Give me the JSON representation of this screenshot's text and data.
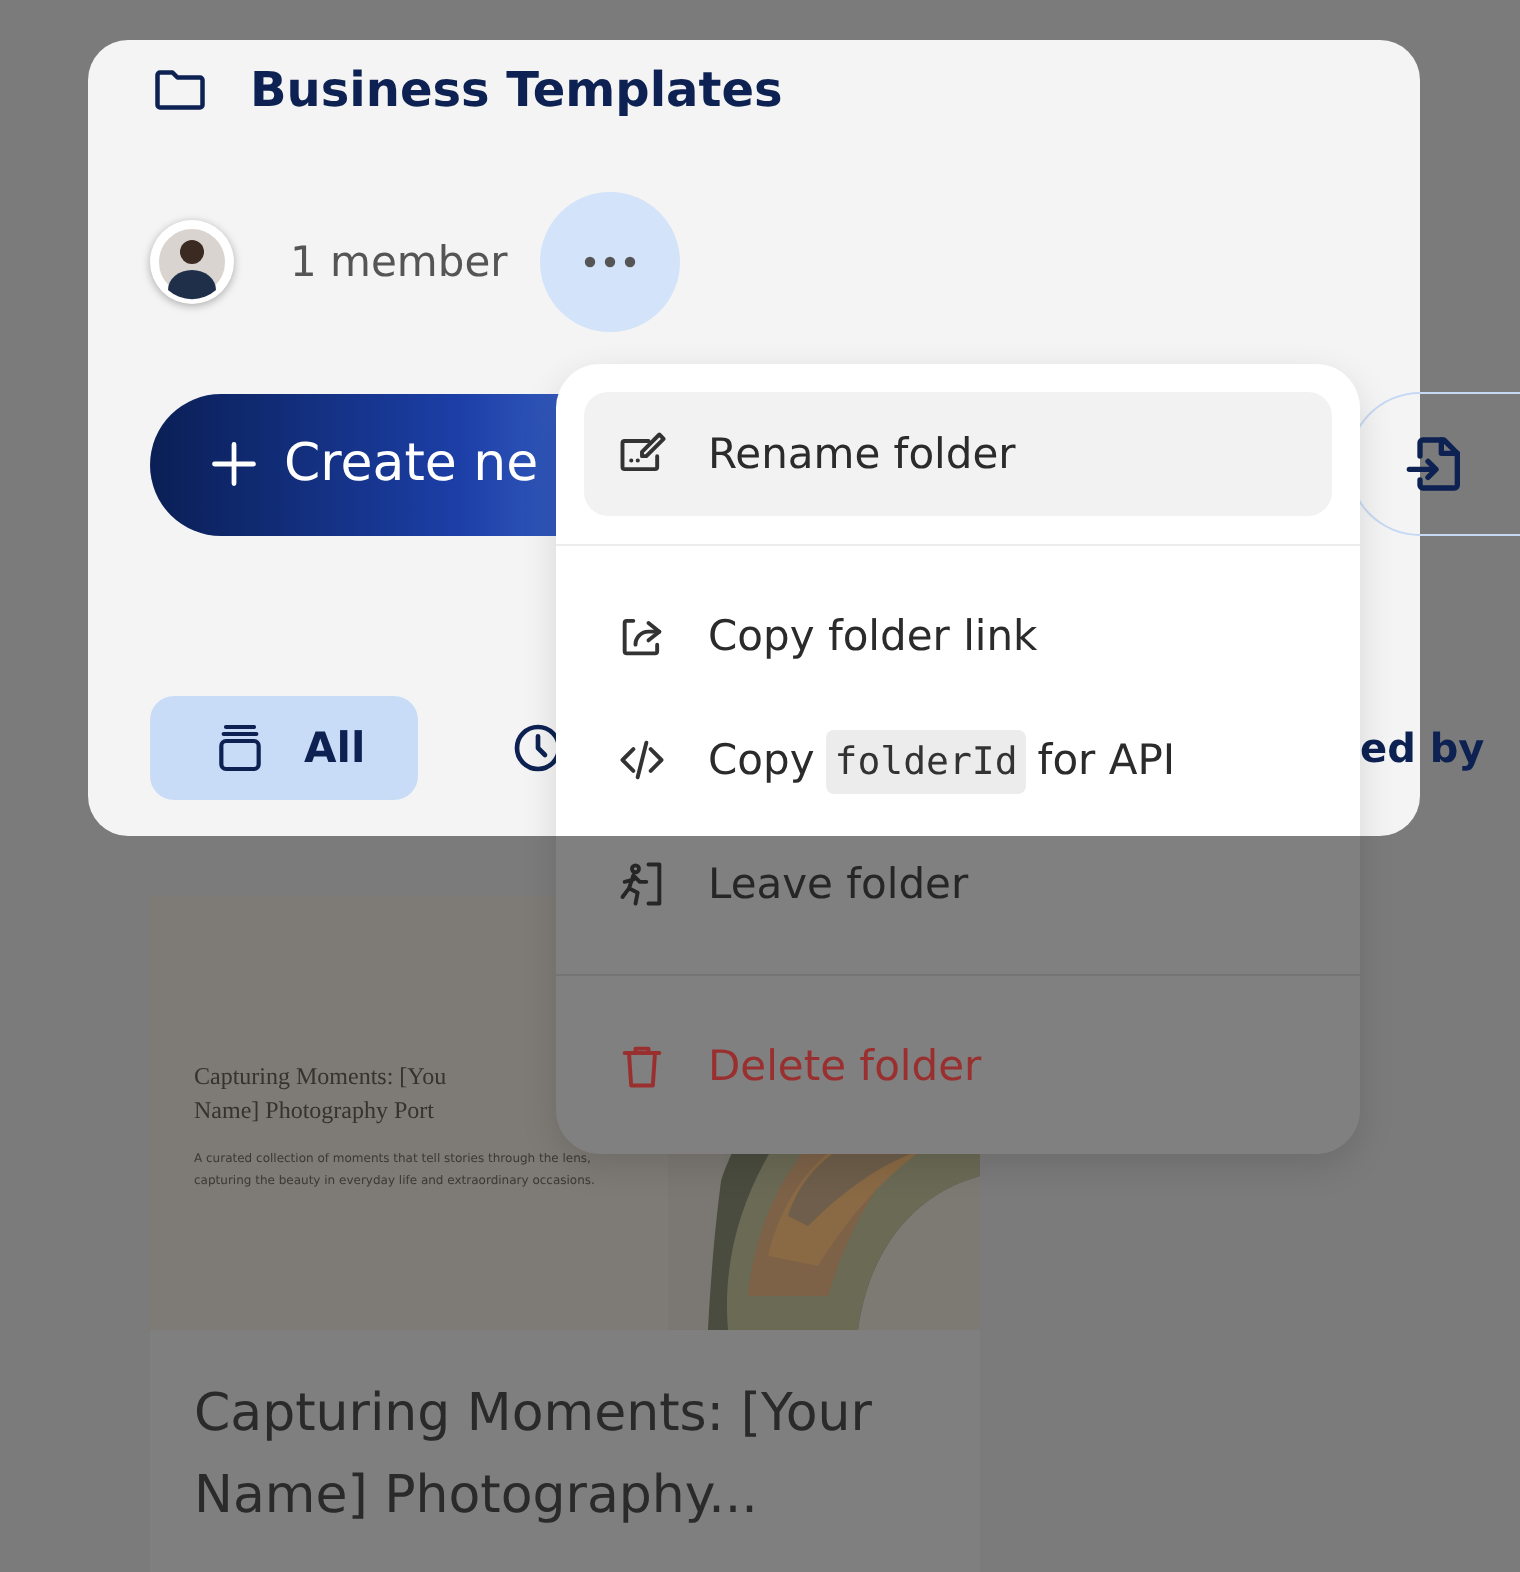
{
  "folder": {
    "title": "Business Templates",
    "members": "1 member"
  },
  "actions": {
    "create_label": "Create ne"
  },
  "tabs": [
    {
      "kind": "all",
      "label": "All",
      "selected": true
    },
    {
      "kind": "recent",
      "selected": false
    },
    {
      "kind": "text",
      "label": "ed by",
      "selected": false
    }
  ],
  "menu": {
    "groups": [
      [
        {
          "kind": "rename",
          "label": "Rename folder",
          "highlighted": true,
          "dimmed": false
        }
      ],
      [
        {
          "kind": "link",
          "label": "Copy folder link",
          "highlighted": false,
          "dimmed": false
        },
        {
          "kind": "api",
          "label": "Copy",
          "code": "folderId",
          "suffix": "for API",
          "highlighted": false,
          "dimmed": false
        },
        {
          "kind": "leave",
          "label": "Leave folder",
          "highlighted": false,
          "dimmed": true
        }
      ],
      [
        {
          "kind": "delete",
          "label": "Delete folder",
          "highlighted": false,
          "dimmed": true
        }
      ]
    ]
  },
  "template": {
    "preview_title_lines": [
      "Capturing Moments: [You",
      "Name] Photography Port"
    ],
    "preview_description": "A curated collection of moments that tell stories through the lens, capturing the beauty in everyday life and extraordinary occasions.",
    "title": "Capturing Moments: [Your Name] Photography..."
  }
}
